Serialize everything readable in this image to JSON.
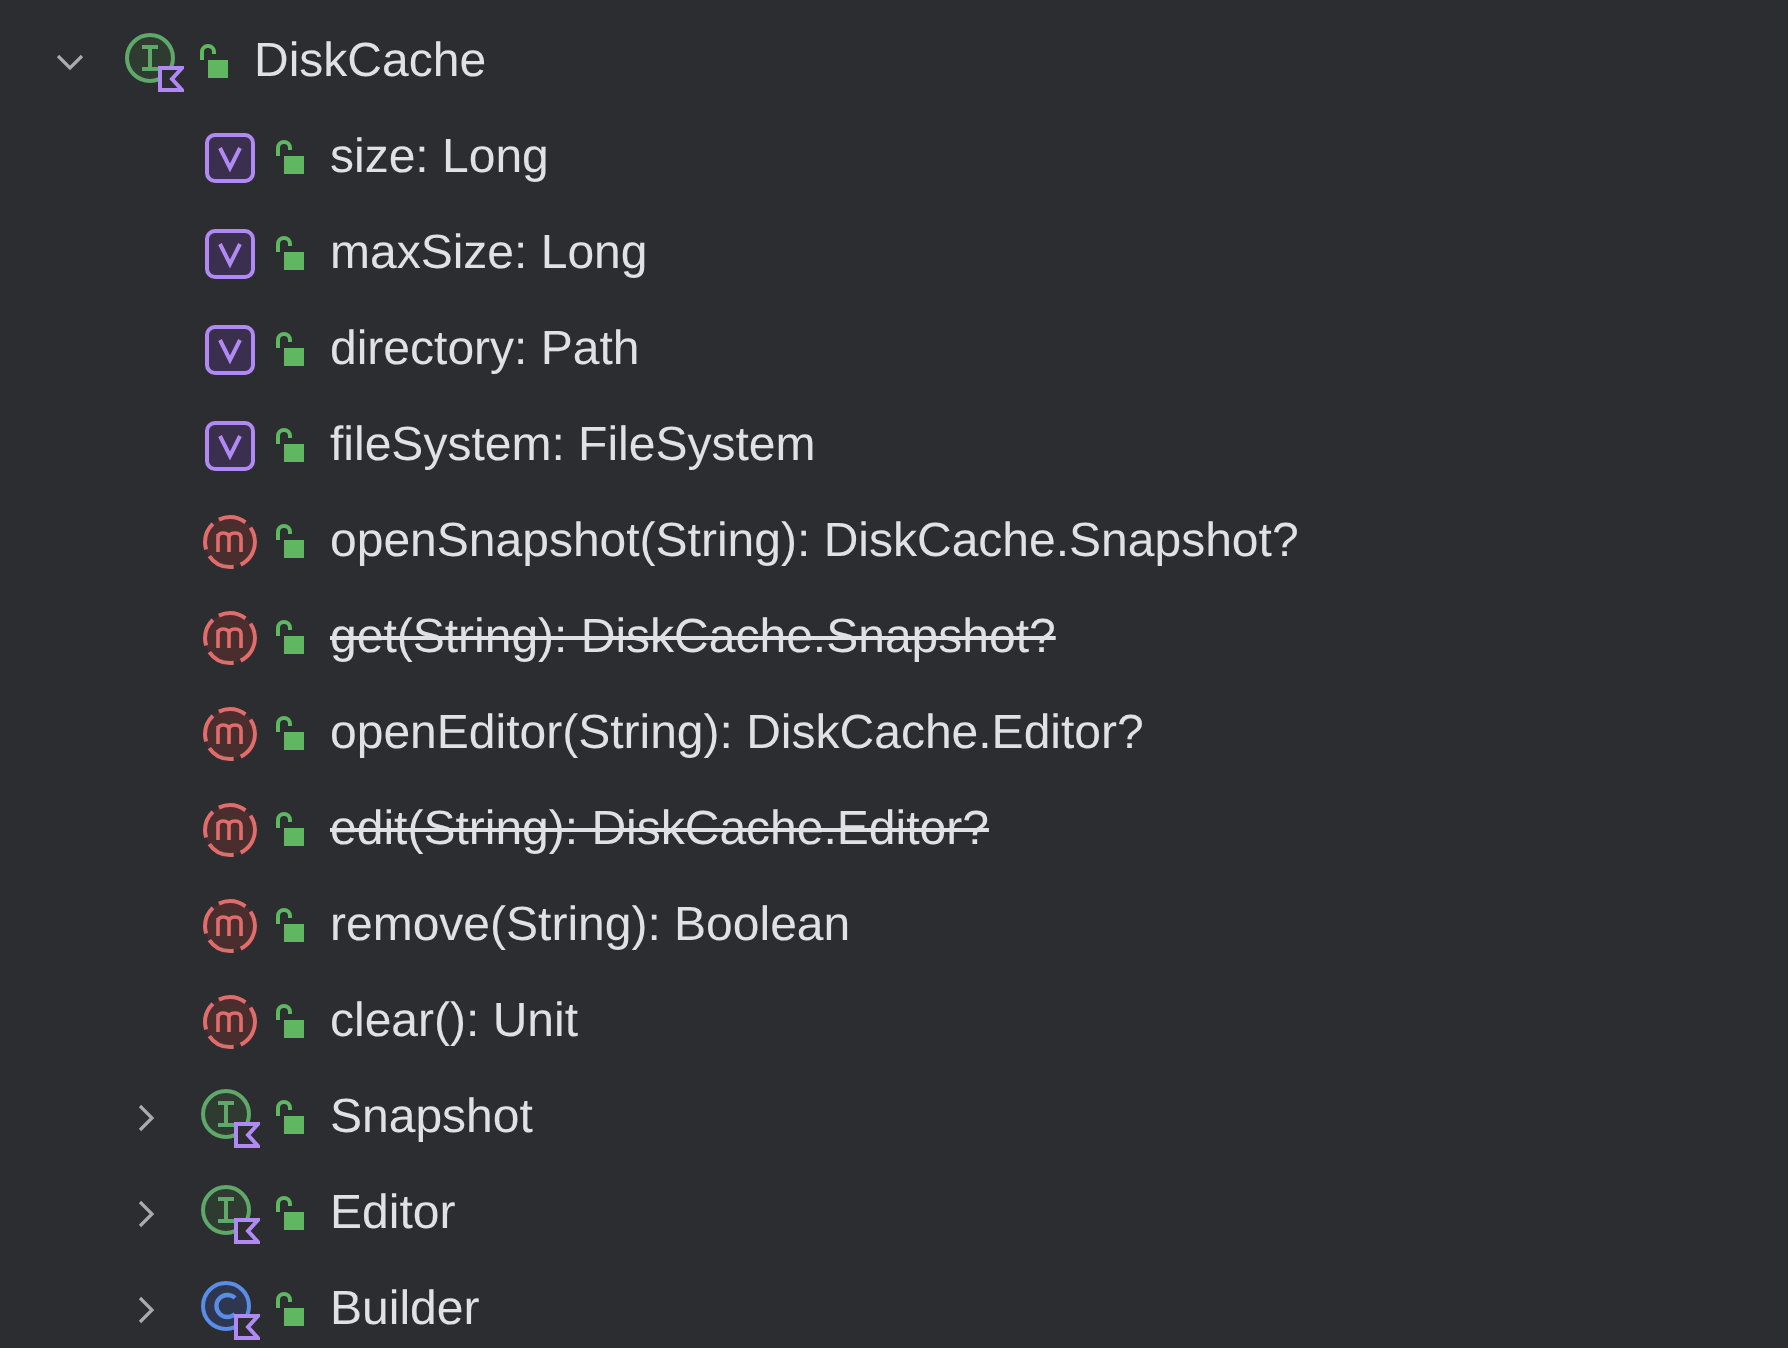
{
  "tree": [
    {
      "kind": "interface",
      "label": "DiskCache",
      "deprecated": false,
      "expanded": true,
      "children": [
        {
          "kind": "property",
          "label": "size: Long",
          "deprecated": false
        },
        {
          "kind": "property",
          "label": "maxSize: Long",
          "deprecated": false
        },
        {
          "kind": "property",
          "label": "directory: Path",
          "deprecated": false
        },
        {
          "kind": "property",
          "label": "fileSystem: FileSystem",
          "deprecated": false
        },
        {
          "kind": "method",
          "label": "openSnapshot(String): DiskCache.Snapshot?",
          "deprecated": false
        },
        {
          "kind": "method",
          "label": "get(String): DiskCache.Snapshot?",
          "deprecated": true
        },
        {
          "kind": "method",
          "label": "openEditor(String): DiskCache.Editor?",
          "deprecated": false
        },
        {
          "kind": "method",
          "label": "edit(String): DiskCache.Editor?",
          "deprecated": true
        },
        {
          "kind": "method",
          "label": "remove(String): Boolean",
          "deprecated": false
        },
        {
          "kind": "method",
          "label": "clear(): Unit",
          "deprecated": false
        },
        {
          "kind": "interface",
          "label": "Snapshot",
          "deprecated": false,
          "expanded": false
        },
        {
          "kind": "interface",
          "label": "Editor",
          "deprecated": false,
          "expanded": false
        },
        {
          "kind": "class",
          "label": "Builder",
          "deprecated": false,
          "expanded": false
        }
      ]
    }
  ]
}
